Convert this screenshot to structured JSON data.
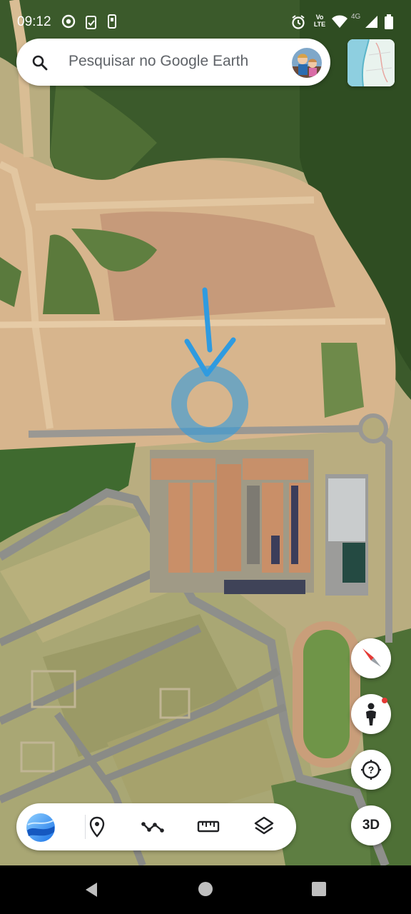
{
  "status_bar": {
    "time": "09:12",
    "left_icons": [
      "chrome-icon",
      "clipboard-check-icon",
      "phone-small-icon"
    ],
    "right_icons": [
      "alarm-icon",
      "volte-icon",
      "wifi-icon",
      "4g-signal-icon",
      "battery-icon"
    ],
    "network_label": "4G",
    "volte_label": "Vo LTE"
  },
  "search": {
    "placeholder": "Pesquisar no Google Earth",
    "icon": "search-icon",
    "avatar": "profile-avatar"
  },
  "minimap": {
    "icon": "minimap-thumbnail"
  },
  "map_controls": {
    "compass": "compass-icon",
    "street_view": "pegman-icon",
    "voyager": "question-circle-icon",
    "toggle_3d_label": "3D"
  },
  "toolbar": {
    "items": [
      {
        "name": "earth-logo-icon"
      },
      {
        "name": "place-pin-icon"
      },
      {
        "name": "path-icon"
      },
      {
        "name": "ruler-icon"
      },
      {
        "name": "layers-icon"
      }
    ]
  },
  "android_nav": [
    "back-icon",
    "home-icon",
    "recents-icon"
  ],
  "colors": {
    "annotation_blue": "#2f9be0",
    "vegetation": "#3a5a2a",
    "soil": "#d8b58c",
    "roof": "#c7906a"
  }
}
